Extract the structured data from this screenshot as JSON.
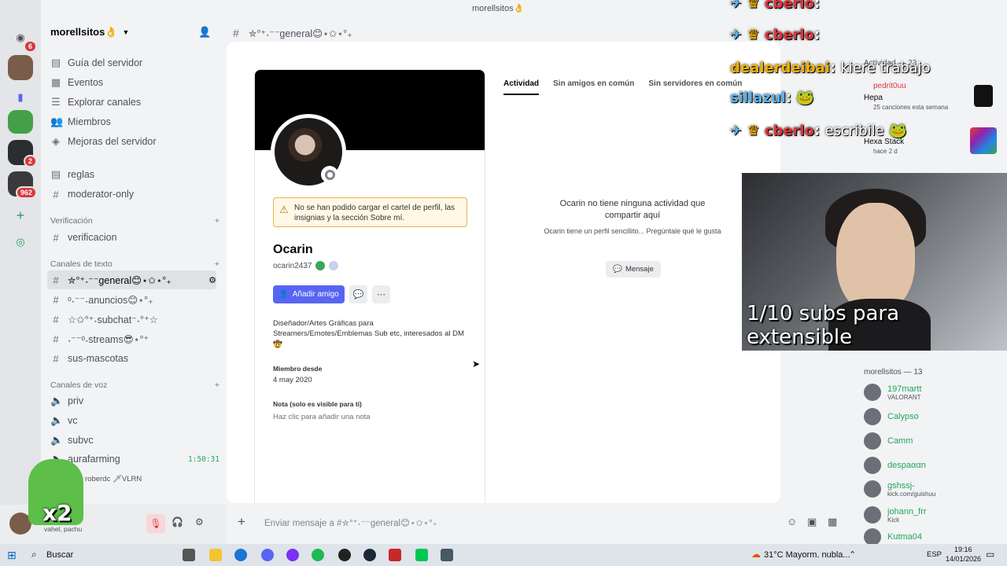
{
  "server": {
    "name": "morellsitos👌",
    "header_channel": "✮°⁺˖⁻⁻general😊⋆✩⋆°₊",
    "nav": [
      {
        "label": "Guía del servidor",
        "icon": "guide-icon"
      },
      {
        "label": "Eventos",
        "icon": "calendar-icon"
      },
      {
        "label": "Explorar canales",
        "icon": "browse-icon"
      },
      {
        "label": "Miembros",
        "icon": "members-icon"
      },
      {
        "label": "Mejoras del servidor",
        "icon": "boost-icon"
      }
    ],
    "channels_top": [
      "reglas",
      "moderator-only"
    ],
    "cat_verif": "Verificación",
    "verif_channel": "verificacion",
    "cat_text": "Canales de texto",
    "text_channels": [
      "✮°⁺˖⁻⁻general😊⋆✩⋆°₊",
      "ᵒ˖⁻⁻˖anuncios😊⋆°₊",
      "☆✩°⁺˖subchat⁻˖°⁺☆",
      "˖⁻⁻ᵒ˖streams😎⋆°⁺"
    ],
    "sus_channel": "sus-mascotas",
    "cat_voice": "Canales de voz",
    "voice_channels": [
      "priv",
      "vc",
      "subvc",
      "aurafarming"
    ],
    "voice_timer": "1:50:31",
    "voice_user": "roberdc 🗡VLRN",
    "badges": {
      "top": "6",
      "s2": "2",
      "s3": "962"
    }
  },
  "user_panel": {
    "name": "morell",
    "status": "vahel, pachu"
  },
  "modal": {
    "warning": "No se han podido cargar el cartel de perfil, las insignias y la sección Sobre mí.",
    "display_name": "Ocarin",
    "username": "ocarin2437",
    "add_friend": "Añadir amigo",
    "bio": "Diseñador/Artes Gráficas para Streamers/Emotes/Emblemas Sub etc, interesados al DM 🤠",
    "member_since_label": "Miembro desde",
    "member_since": "4 may 2020",
    "note_label": "Nota (solo es visible para ti)",
    "note_placeholder": "Haz clic para añadir una nota",
    "tabs": [
      "Actividad",
      "Sin amigos en común",
      "Sin servidores en común"
    ],
    "empty_title": "Ocarin no tiene ninguna actividad que compartir aquí",
    "empty_sub": "Ocarin tiene un perfil sencillito... Pregúntale qué le gusta",
    "message_button": "Mensaje"
  },
  "members": {
    "activity_header": "Actividad — 23",
    "act1_name": "pedrit0uu",
    "act1_title": "Hepa",
    "act1_sub": "25 canciones esta semana",
    "act2_title": "Hexa Stack",
    "act2_sub": "hace 2 d",
    "online_header": "morellsitos — 13",
    "list": [
      {
        "name": "197martt",
        "sub": "VALORANT"
      },
      {
        "name": "Calypso",
        "sub": ""
      },
      {
        "name": "Camm",
        "sub": ""
      },
      {
        "name": "despaααn",
        "sub": ""
      },
      {
        "name": "gshssj-",
        "sub": "kick.com/guishuu"
      },
      {
        "name": "johann_frr",
        "sub": "Kick"
      },
      {
        "name": "Kutma04",
        "sub": ""
      }
    ]
  },
  "chat_input": {
    "placeholder": "Enviar mensaje a #✮°⁺˖⁻⁻general😊⋆✩⋆°₊"
  },
  "window_title": "morellsitos👌",
  "stream_chat": [
    {
      "user": "cberlo",
      "msg": ""
    },
    {
      "user": "cberlo",
      "msg": ""
    },
    {
      "user": "dealerdeibai",
      "msg": "kiere trabajo"
    },
    {
      "user": "sillazul",
      "msg": ""
    },
    {
      "user": "cberlo",
      "msg": "escribile"
    }
  ],
  "webcam_caption": "1/10 subs para extensible",
  "sticker_text": "x2",
  "taskbar": {
    "search": "Buscar",
    "weather": "31°C  Mayorm. nubla...",
    "lang": "ESP",
    "time": "19:16",
    "date": "14/01/2026"
  }
}
